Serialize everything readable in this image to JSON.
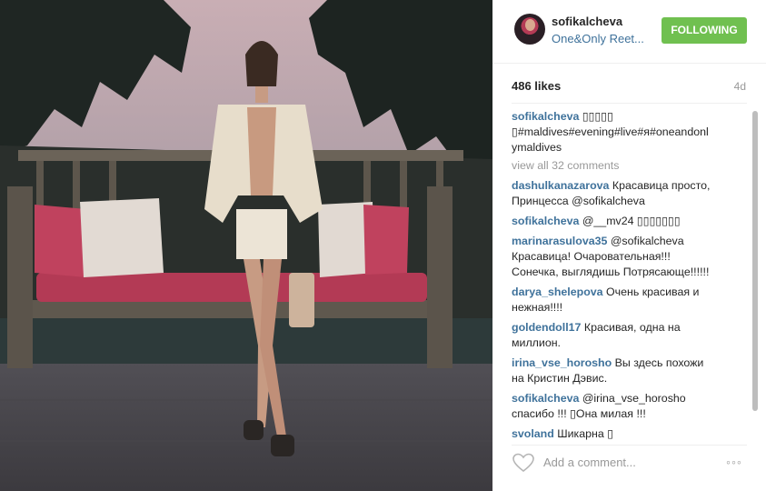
{
  "post": {
    "username": "sofikalcheva",
    "location": "One&Only Reet...",
    "follow_label": "FOLLOWING",
    "likes": "486 likes",
    "age": "4d",
    "caption_user": "sofikalcheva",
    "caption_text": " ▯▯▯▯▯",
    "caption_line2": "▯#maldives#evening#live#я#oneandonl",
    "caption_line3": "ymaldives",
    "view_all": "view all 32 comments",
    "add_comment_placeholder": "Add a comment...",
    "more_label": "◦◦◦"
  },
  "comments": [
    {
      "user": "dashulkanazarova",
      "lines": [
        " Красавица просто,",
        "Принцесса @sofikalcheva"
      ]
    },
    {
      "user": "sofikalcheva",
      "lines": [
        " @__mv24 ▯▯▯▯▯▯▯"
      ]
    },
    {
      "user": "marinarasulova35",
      "lines": [
        " @sofikalcheva",
        "Красавица! Очаровательная!!!",
        "Сонечка, выглядишь Потрясающе!!!!!!"
      ]
    },
    {
      "user": "darya_shelepova",
      "lines": [
        " Очень красивая и",
        "нежная!!!!"
      ]
    },
    {
      "user": "goldendoll17",
      "lines": [
        " Красивая, одна на",
        "миллион."
      ]
    },
    {
      "user": "irina_vse_horosho",
      "lines": [
        " Вы здесь похожи",
        "на Кристин Дэвис."
      ]
    },
    {
      "user": "sofikalcheva",
      "lines": [
        " @irina_vse_horosho",
        "спасибо !!! ▯Она милая !!!"
      ]
    },
    {
      "user": "svoland",
      "lines": [
        " Шикарна ▯"
      ]
    }
  ],
  "colors": {
    "follow_green": "#70c050",
    "link_blue": "#3f729b",
    "muted": "#999999"
  },
  "icons": {
    "heart": "heart-outline-icon",
    "more": "ellipsis-icon"
  }
}
